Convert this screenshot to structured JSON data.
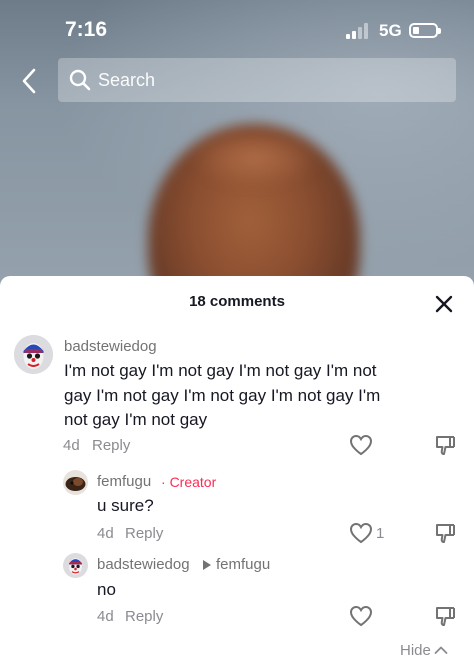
{
  "status_bar": {
    "time": "7:16",
    "network": "5G"
  },
  "nav": {
    "back_icon": "chevron-left-icon",
    "search_placeholder": "Search",
    "search_icon": "search-icon"
  },
  "comments": {
    "count_label": "18 comments",
    "close_icon": "close-icon",
    "items": [
      {
        "username": "badstewiedog",
        "text": "I'm not gay I'm not gay I'm not gay I'm not gay I'm not gay I'm not gay I'm not gay I'm not gay I'm not gay",
        "age": "4d",
        "reply_label": "Reply",
        "like_count": ""
      },
      {
        "username": "femfugu",
        "badge": "Creator",
        "badge_separator": "·",
        "text": "u sure?",
        "age": "4d",
        "reply_label": "Reply",
        "like_count": "1"
      },
      {
        "username": "badstewiedog",
        "reply_to": "femfugu",
        "text": "no",
        "age": "4d",
        "reply_label": "Reply",
        "like_count": ""
      }
    ],
    "hide_label": "Hide"
  },
  "colors": {
    "accent_creator": "#fe2c55",
    "text_primary": "#161823",
    "text_secondary": "#8a8b91"
  }
}
